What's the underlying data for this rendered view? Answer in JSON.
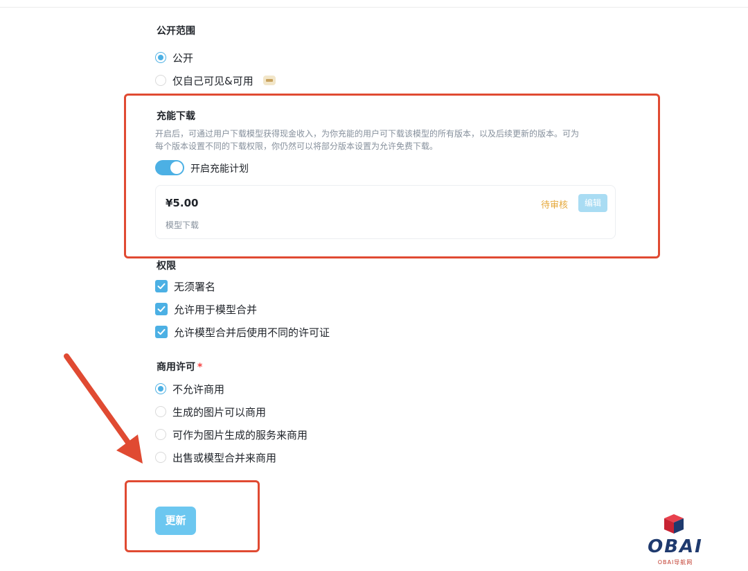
{
  "visibility": {
    "title": "公开范围",
    "options": [
      {
        "label": "公开",
        "checked": true
      },
      {
        "label": "仅自己可见&可用",
        "checked": false,
        "badge": "pro"
      }
    ]
  },
  "charging": {
    "title": "充能下载",
    "description_line1": "开启后，可通过用户下载模型获得现金收入，为你充能的用户可下载该模型的所有版本，以及后续更新的版本。可为",
    "description_line2": "每个版本设置不同的下载权限，你仍然可以将部分版本设置为允许免费下载。",
    "toggle_label": "开启充能计划",
    "toggle_on": true,
    "price_card": {
      "price": "¥5.00",
      "subtitle": "模型下载",
      "status": "待审核",
      "edit_label": "编辑"
    }
  },
  "permissions": {
    "title": "权限",
    "items": [
      {
        "label": "无须署名",
        "checked": true
      },
      {
        "label": "允许用于模型合并",
        "checked": true
      },
      {
        "label": "允许模型合并后使用不同的许可证",
        "checked": true
      }
    ]
  },
  "commercial": {
    "title": "商用许可",
    "required_mark": "*",
    "options": [
      {
        "label": "不允许商用",
        "checked": true
      },
      {
        "label": "生成的图片可以商用",
        "checked": false
      },
      {
        "label": "可作为图片生成的服务来商用",
        "checked": false
      },
      {
        "label": "出售或模型合并来商用",
        "checked": false
      }
    ]
  },
  "update_button": "更新",
  "watermark": {
    "brand": "OBAI",
    "sub": "OBAI导航网"
  },
  "colors": {
    "accent": "#4cb0e4",
    "annotation": "#e04a32",
    "pending": "#e5a83a"
  }
}
